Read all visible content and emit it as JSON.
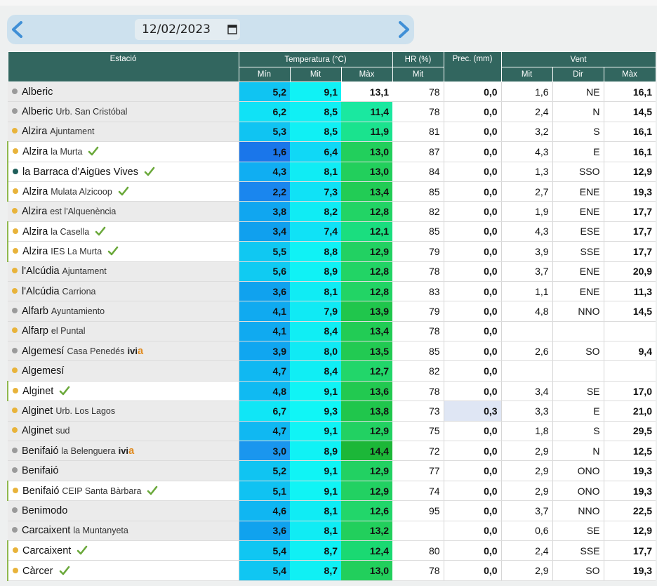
{
  "date": {
    "value": "12/02/2023"
  },
  "colors": {
    "header": "#32665f",
    "dot_yellow": "#e8b33a",
    "dot_gray": "#9a9a9a",
    "dot_teal": "#1f5e5a",
    "check": "#6aa83a",
    "prec_highlight": "#dfe6f4"
  },
  "table": {
    "headers": {
      "station": "Estació",
      "temperature": "Temperatura (°C)",
      "humidity": "HR (%)",
      "precipitation": "Prec. (mm)",
      "wind": "Vent"
    },
    "subheaders": {
      "tmin": "Mín",
      "tavg": "Mit",
      "tmax": "Màx",
      "hr": "Mit",
      "wavg": "Mit",
      "wdir": "Dir",
      "wmax": "Màx"
    },
    "rows": [
      {
        "name": "Alberic",
        "sub": "",
        "ivia": false,
        "dot": "gray",
        "check": false,
        "style": "gray",
        "tmin": "5,2",
        "tavg": "9,1",
        "tmax": "13,1",
        "hr": "78",
        "prec": "0,0",
        "wavg": "1,6",
        "wdir": "NE",
        "wmax": "16,1",
        "cmin": "#10c4f2",
        "cavg": "#10f2f5",
        "cmax": "#ffffff"
      },
      {
        "name": "Alberic",
        "sub": "Urb. San Cristóbal",
        "ivia": false,
        "dot": "gray",
        "check": false,
        "style": "gray",
        "tmin": "6,2",
        "tavg": "8,5",
        "tmax": "11,4",
        "hr": "78",
        "prec": "0,0",
        "wavg": "2,4",
        "wdir": "N",
        "wmax": "14,5",
        "cmin": "#10e2f6",
        "cavg": "#10f0f4",
        "cmax": "#1ae8a0"
      },
      {
        "name": "Alzira",
        "sub": "Ajuntament",
        "ivia": false,
        "dot": "yellow",
        "check": false,
        "style": "gray",
        "tmin": "5,3",
        "tavg": "8,5",
        "tmax": "11,9",
        "hr": "81",
        "prec": "0,0",
        "wavg": "3,2",
        "wdir": "S",
        "wmax": "16,1",
        "cmin": "#10c4f2",
        "cavg": "#10f0f4",
        "cmax": "#1ae38e"
      },
      {
        "name": "Alzira",
        "sub": "la Murta",
        "ivia": false,
        "dot": "yellow",
        "check": true,
        "style": "white",
        "tmin": "1,6",
        "tavg": "6,4",
        "tmax": "13,0",
        "hr": "87",
        "prec": "0,0",
        "wavg": "4,3",
        "wdir": "E",
        "wmax": "16,1",
        "cmin": "#1a76ea",
        "cavg": "#10d8f6",
        "cmax": "#22cf5c"
      },
      {
        "name": "la Barraca d’Aigües Vives",
        "sub": "",
        "ivia": false,
        "dot": "teal",
        "check": true,
        "style": "white",
        "tmin": "4,3",
        "tavg": "8,1",
        "tmax": "13,0",
        "hr": "84",
        "prec": "0,0",
        "wavg": "1,3",
        "wdir": "SSO",
        "wmax": "12,9",
        "cmin": "#10aef2",
        "cavg": "#10ecf4",
        "cmax": "#22cf5c"
      },
      {
        "name": "Alzira",
        "sub": "Mulata Alzicoop",
        "ivia": false,
        "dot": "yellow",
        "check": true,
        "style": "white",
        "tmin": "2,2",
        "tavg": "7,3",
        "tmax": "13,4",
        "hr": "85",
        "prec": "0,0",
        "wavg": "2,7",
        "wdir": "ENE",
        "wmax": "19,3",
        "cmin": "#1a86ee",
        "cavg": "#10e2f6",
        "cmax": "#22cc55"
      },
      {
        "name": "Alzira",
        "sub": "est l'Alquenència",
        "ivia": false,
        "dot": "yellow",
        "check": false,
        "style": "gray",
        "tmin": "3,8",
        "tavg": "8,2",
        "tmax": "12,8",
        "hr": "82",
        "prec": "0,0",
        "wavg": "1,9",
        "wdir": "ENE",
        "wmax": "17,7",
        "cmin": "#10a6f0",
        "cavg": "#10ecf4",
        "cmax": "#22d465"
      },
      {
        "name": "Alzira",
        "sub": "la Casella",
        "ivia": false,
        "dot": "yellow",
        "check": true,
        "style": "white",
        "tmin": "3,4",
        "tavg": "7,4",
        "tmax": "12,1",
        "hr": "85",
        "prec": "0,0",
        "wavg": "4,3",
        "wdir": "ESE",
        "wmax": "17,7",
        "cmin": "#10a0ee",
        "cavg": "#10e2f6",
        "cmax": "#1ade7f"
      },
      {
        "name": "Alzira",
        "sub": "IES La Murta",
        "ivia": false,
        "dot": "yellow",
        "check": true,
        "style": "white",
        "tmin": "5,5",
        "tavg": "8,8",
        "tmax": "12,9",
        "hr": "79",
        "prec": "0,0",
        "wavg": "3,9",
        "wdir": "SSE",
        "wmax": "17,7",
        "cmin": "#10c8f2",
        "cavg": "#10f2f5",
        "cmax": "#22d162"
      },
      {
        "name": "l'Alcúdia",
        "sub": "Ajuntament",
        "ivia": false,
        "dot": "yellow",
        "check": false,
        "style": "gray",
        "tmin": "5,6",
        "tavg": "8,9",
        "tmax": "12,8",
        "hr": "78",
        "prec": "0,0",
        "wavg": "3,7",
        "wdir": "ENE",
        "wmax": "20,9",
        "cmin": "#10cbf2",
        "cavg": "#10f2f5",
        "cmax": "#22d465"
      },
      {
        "name": "l'Alcúdia",
        "sub": "Carriona",
        "ivia": false,
        "dot": "yellow",
        "check": false,
        "style": "gray",
        "tmin": "3,6",
        "tavg": "8,1",
        "tmax": "12,8",
        "hr": "83",
        "prec": "0,0",
        "wavg": "1,1",
        "wdir": "ENE",
        "wmax": "11,3",
        "cmin": "#10a2ee",
        "cavg": "#10ecf4",
        "cmax": "#22d465"
      },
      {
        "name": "Alfarb",
        "sub": "Ayuntamiento",
        "ivia": false,
        "dot": "gray",
        "check": false,
        "style": "gray",
        "tmin": "4,1",
        "tavg": "7,9",
        "tmax": "13,9",
        "hr": "79",
        "prec": "0,0",
        "wavg": "4,8",
        "wdir": "NNO",
        "wmax": "14,5",
        "cmin": "#10aaf0",
        "cavg": "#10eaf4",
        "cmax": "#20c64c"
      },
      {
        "name": "Alfarp",
        "sub": "el Puntal",
        "ivia": false,
        "dot": "yellow",
        "check": false,
        "style": "gray",
        "tmin": "4,1",
        "tavg": "8,4",
        "tmax": "13,4",
        "hr": "78",
        "prec": "0,0",
        "wavg": "",
        "wdir": "",
        "wmax": "",
        "cmin": "#10aaf0",
        "cavg": "#10eef4",
        "cmax": "#22cc55"
      },
      {
        "name": "Algemesí",
        "sub": "Casa Penedés",
        "ivia": true,
        "dot": "gray",
        "check": false,
        "style": "gray",
        "tmin": "3,9",
        "tavg": "8,0",
        "tmax": "13,5",
        "hr": "85",
        "prec": "0,0",
        "wavg": "2,6",
        "wdir": "SO",
        "wmax": "9,4",
        "cmin": "#10a6f0",
        "cavg": "#10eaf4",
        "cmax": "#22ca52"
      },
      {
        "name": "Algemesí",
        "sub": "",
        "ivia": false,
        "dot": "yellow",
        "check": false,
        "style": "gray",
        "tmin": "4,7",
        "tavg": "8,4",
        "tmax": "12,7",
        "hr": "82",
        "prec": "0,0",
        "wavg": "",
        "wdir": "",
        "wmax": "",
        "cmin": "#10b8f2",
        "cavg": "#10eef4",
        "cmax": "#22d66a"
      },
      {
        "name": "Alginet",
        "sub": "",
        "ivia": false,
        "dot": "yellow",
        "check": true,
        "style": "white",
        "tmin": "4,8",
        "tavg": "9,1",
        "tmax": "13,6",
        "hr": "78",
        "prec": "0,0",
        "wavg": "3,4",
        "wdir": "SE",
        "wmax": "17,0",
        "cmin": "#10baf2",
        "cavg": "#10f4f5",
        "cmax": "#22c950"
      },
      {
        "name": "Alginet",
        "sub": "Urb. Los Lagos",
        "ivia": false,
        "dot": "yellow",
        "check": false,
        "style": "gray",
        "tmin": "6,7",
        "tavg": "9,3",
        "tmax": "13,8",
        "hr": "73",
        "prec": "0,3",
        "wavg": "3,3",
        "wdir": "E",
        "wmax": "21,0",
        "cmin": "#10e6f6",
        "cavg": "#10f6f6",
        "cmax": "#20c64c"
      },
      {
        "name": "Alginet",
        "sub": "sud",
        "ivia": false,
        "dot": "yellow",
        "check": false,
        "style": "gray",
        "tmin": "4,7",
        "tavg": "9,1",
        "tmax": "12,9",
        "hr": "75",
        "prec": "0,0",
        "wavg": "1,8",
        "wdir": "S",
        "wmax": "29,5",
        "cmin": "#10b8f2",
        "cavg": "#10f4f5",
        "cmax": "#22d162"
      },
      {
        "name": "Benifaió",
        "sub": "la Belenguera",
        "ivia": true,
        "dot": "gray",
        "check": false,
        "style": "gray",
        "tmin": "3,0",
        "tavg": "8,9",
        "tmax": "14,4",
        "hr": "72",
        "prec": "0,0",
        "wavg": "2,9",
        "wdir": "N",
        "wmax": "12,5",
        "cmin": "#1a96ee",
        "cavg": "#10f2f5",
        "cmax": "#1cb738"
      },
      {
        "name": "Benifaió",
        "sub": "",
        "ivia": false,
        "dot": "gray",
        "check": false,
        "style": "gray",
        "tmin": "5,2",
        "tavg": "9,1",
        "tmax": "12,9",
        "hr": "77",
        "prec": "0,0",
        "wavg": "2,9",
        "wdir": "ONO",
        "wmax": "19,3",
        "cmin": "#10c4f2",
        "cavg": "#10f4f5",
        "cmax": "#22d162"
      },
      {
        "name": "Benifaió",
        "sub": "CEIP Santa Bàrbara",
        "ivia": false,
        "dot": "yellow",
        "check": true,
        "style": "white",
        "tmin": "5,1",
        "tavg": "9,1",
        "tmax": "12,9",
        "hr": "74",
        "prec": "0,0",
        "wavg": "2,9",
        "wdir": "ONO",
        "wmax": "19,3",
        "cmin": "#10c2f2",
        "cavg": "#10f4f5",
        "cmax": "#22d162"
      },
      {
        "name": "Benimodo",
        "sub": "",
        "ivia": false,
        "dot": "gray",
        "check": false,
        "style": "gray",
        "tmin": "4,6",
        "tavg": "8,1",
        "tmax": "12,6",
        "hr": "95",
        "prec": "0,0",
        "wavg": "3,7",
        "wdir": "NNO",
        "wmax": "22,5",
        "cmin": "#10b6f2",
        "cavg": "#10ecf4",
        "cmax": "#22d66a"
      },
      {
        "name": "Carcaixent",
        "sub": "la Muntanyeta",
        "ivia": false,
        "dot": "gray",
        "check": false,
        "style": "gray",
        "tmin": "3,6",
        "tavg": "8,1",
        "tmax": "13,2",
        "hr": "",
        "prec": "0,0",
        "wavg": "0,6",
        "wdir": "SE",
        "wmax": "12,9",
        "cmin": "#10a2ee",
        "cavg": "#10ecf4",
        "cmax": "#22cf5c"
      },
      {
        "name": "Carcaixent",
        "sub": "",
        "ivia": false,
        "dot": "yellow",
        "check": true,
        "style": "white",
        "tmin": "5,4",
        "tavg": "8,7",
        "tmax": "12,4",
        "hr": "80",
        "prec": "0,0",
        "wavg": "2,4",
        "wdir": "SSE",
        "wmax": "17,7",
        "cmin": "#10c6f2",
        "cavg": "#10f0f4",
        "cmax": "#1ad972"
      },
      {
        "name": "Càrcer",
        "sub": "",
        "ivia": false,
        "dot": "yellow",
        "check": true,
        "style": "white",
        "tmin": "5,4",
        "tavg": "8,7",
        "tmax": "13,0",
        "hr": "78",
        "prec": "0,0",
        "wavg": "2,9",
        "wdir": "SO",
        "wmax": "19,3",
        "cmin": "#10c6f2",
        "cavg": "#10f0f4",
        "cmax": "#22cf5c"
      }
    ]
  }
}
